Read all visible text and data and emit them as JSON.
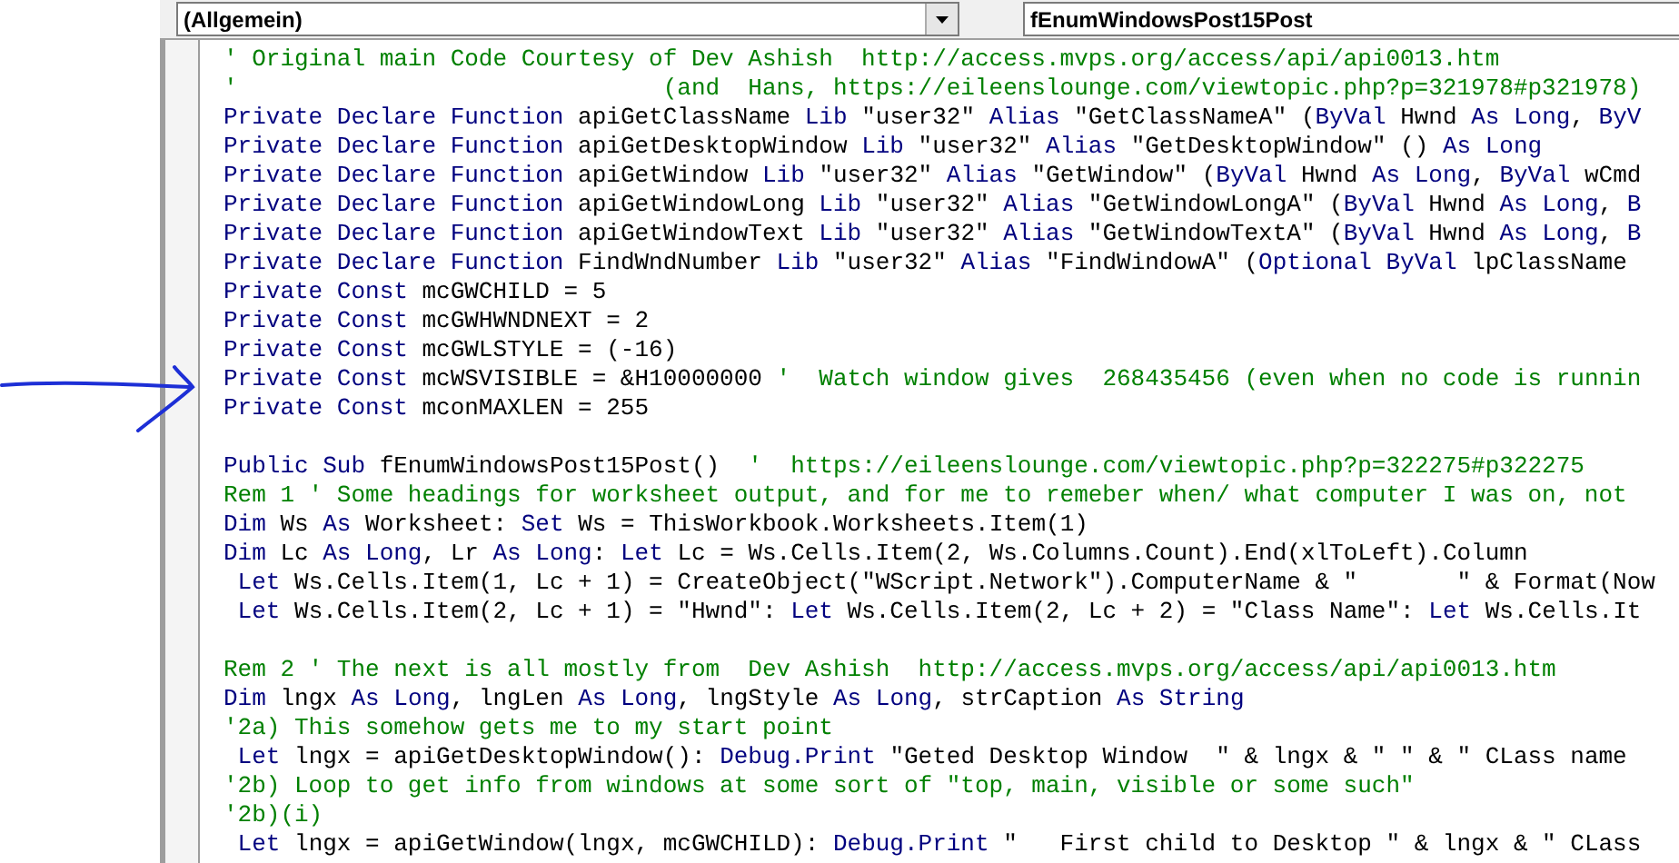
{
  "object_dropdown": {
    "value": "(Allgemein)"
  },
  "procedure_dropdown": {
    "value": "fEnumWindowsPost15Post"
  },
  "code_lines": [
    {
      "kind": "code",
      "segments": [
        {
          "kind": "comment",
          "text": "' Original main Code Courtesy of Dev Ashish  http://access.mvps.org/access/api/api0013.htm"
        }
      ]
    },
    {
      "kind": "code",
      "segments": [
        {
          "kind": "comment",
          "text": "'                              (and  Hans, https://eileenslounge.com/viewtopic.php?p=321978#p321978)"
        }
      ]
    },
    {
      "kind": "code",
      "segments": [
        {
          "kind": "keyword",
          "text": "Private Declare Function "
        },
        {
          "kind": "plain",
          "text": "apiGetClassName "
        },
        {
          "kind": "keyword",
          "text": "Lib "
        },
        {
          "kind": "plain",
          "text": "\"user32\" "
        },
        {
          "kind": "keyword",
          "text": "Alias "
        },
        {
          "kind": "plain",
          "text": "\"GetClassNameA\" ("
        },
        {
          "kind": "keyword",
          "text": "ByVal "
        },
        {
          "kind": "plain",
          "text": "Hwnd "
        },
        {
          "kind": "keyword",
          "text": "As Long"
        },
        {
          "kind": "plain",
          "text": ", "
        },
        {
          "kind": "keyword",
          "text": "ByV"
        }
      ]
    },
    {
      "kind": "code",
      "segments": [
        {
          "kind": "keyword",
          "text": "Private Declare Function "
        },
        {
          "kind": "plain",
          "text": "apiGetDesktopWindow "
        },
        {
          "kind": "keyword",
          "text": "Lib "
        },
        {
          "kind": "plain",
          "text": "\"user32\" "
        },
        {
          "kind": "keyword",
          "text": "Alias "
        },
        {
          "kind": "plain",
          "text": "\"GetDesktopWindow\" () "
        },
        {
          "kind": "keyword",
          "text": "As Long"
        }
      ]
    },
    {
      "kind": "code",
      "segments": [
        {
          "kind": "keyword",
          "text": "Private Declare Function "
        },
        {
          "kind": "plain",
          "text": "apiGetWindow "
        },
        {
          "kind": "keyword",
          "text": "Lib "
        },
        {
          "kind": "plain",
          "text": "\"user32\" "
        },
        {
          "kind": "keyword",
          "text": "Alias "
        },
        {
          "kind": "plain",
          "text": "\"GetWindow\" ("
        },
        {
          "kind": "keyword",
          "text": "ByVal "
        },
        {
          "kind": "plain",
          "text": "Hwnd "
        },
        {
          "kind": "keyword",
          "text": "As Long"
        },
        {
          "kind": "plain",
          "text": ", "
        },
        {
          "kind": "keyword",
          "text": "ByVal "
        },
        {
          "kind": "plain",
          "text": "wCmd"
        }
      ]
    },
    {
      "kind": "code",
      "segments": [
        {
          "kind": "keyword",
          "text": "Private Declare Function "
        },
        {
          "kind": "plain",
          "text": "apiGetWindowLong "
        },
        {
          "kind": "keyword",
          "text": "Lib "
        },
        {
          "kind": "plain",
          "text": "\"user32\" "
        },
        {
          "kind": "keyword",
          "text": "Alias "
        },
        {
          "kind": "plain",
          "text": "\"GetWindowLongA\" ("
        },
        {
          "kind": "keyword",
          "text": "ByVal "
        },
        {
          "kind": "plain",
          "text": "Hwnd "
        },
        {
          "kind": "keyword",
          "text": "As Long"
        },
        {
          "kind": "plain",
          "text": ", "
        },
        {
          "kind": "keyword",
          "text": "B"
        }
      ]
    },
    {
      "kind": "code",
      "segments": [
        {
          "kind": "keyword",
          "text": "Private Declare Function "
        },
        {
          "kind": "plain",
          "text": "apiGetWindowText "
        },
        {
          "kind": "keyword",
          "text": "Lib "
        },
        {
          "kind": "plain",
          "text": "\"user32\" "
        },
        {
          "kind": "keyword",
          "text": "Alias "
        },
        {
          "kind": "plain",
          "text": "\"GetWindowTextA\" ("
        },
        {
          "kind": "keyword",
          "text": "ByVal "
        },
        {
          "kind": "plain",
          "text": "Hwnd "
        },
        {
          "kind": "keyword",
          "text": "As Long"
        },
        {
          "kind": "plain",
          "text": ", "
        },
        {
          "kind": "keyword",
          "text": "B"
        }
      ]
    },
    {
      "kind": "code",
      "segments": [
        {
          "kind": "keyword",
          "text": "Private Declare Function "
        },
        {
          "kind": "plain",
          "text": "FindWndNumber "
        },
        {
          "kind": "keyword",
          "text": "Lib "
        },
        {
          "kind": "plain",
          "text": "\"user32\" "
        },
        {
          "kind": "keyword",
          "text": "Alias "
        },
        {
          "kind": "plain",
          "text": "\"FindWindowA\" ("
        },
        {
          "kind": "keyword",
          "text": "Optional ByVal "
        },
        {
          "kind": "plain",
          "text": "lpClassName"
        }
      ]
    },
    {
      "kind": "code",
      "segments": [
        {
          "kind": "keyword",
          "text": "Private Const "
        },
        {
          "kind": "plain",
          "text": "mcGWCHILD = 5"
        }
      ]
    },
    {
      "kind": "code",
      "segments": [
        {
          "kind": "keyword",
          "text": "Private Const "
        },
        {
          "kind": "plain",
          "text": "mcGWHWNDNEXT = 2"
        }
      ]
    },
    {
      "kind": "code",
      "segments": [
        {
          "kind": "keyword",
          "text": "Private Const "
        },
        {
          "kind": "plain",
          "text": "mcGWLSTYLE = (-16)"
        }
      ]
    },
    {
      "kind": "code",
      "segments": [
        {
          "kind": "keyword",
          "text": "Private Const "
        },
        {
          "kind": "plain",
          "text": "mcWSVISIBLE = &H10000000 "
        },
        {
          "kind": "comment",
          "text": "'  Watch window gives  268435456 (even when no code is runnin"
        }
      ]
    },
    {
      "kind": "code",
      "segments": [
        {
          "kind": "keyword",
          "text": "Private Const "
        },
        {
          "kind": "plain",
          "text": "mconMAXLEN = 255"
        }
      ]
    },
    {
      "kind": "blank"
    },
    {
      "kind": "code",
      "segments": [
        {
          "kind": "keyword",
          "text": "Public Sub "
        },
        {
          "kind": "plain",
          "text": "fEnumWindowsPost15Post()  "
        },
        {
          "kind": "comment",
          "text": "'  https://eileenslounge.com/viewtopic.php?p=322275#p322275"
        }
      ]
    },
    {
      "kind": "code",
      "segments": [
        {
          "kind": "comment",
          "text": "Rem 1 ' Some headings for worksheet output, and for me to remeber when/ what computer I was on, not"
        }
      ]
    },
    {
      "kind": "code",
      "segments": [
        {
          "kind": "keyword",
          "text": "Dim "
        },
        {
          "kind": "plain",
          "text": "Ws "
        },
        {
          "kind": "keyword",
          "text": "As "
        },
        {
          "kind": "plain",
          "text": "Worksheet: "
        },
        {
          "kind": "keyword",
          "text": "Set "
        },
        {
          "kind": "plain",
          "text": "Ws = ThisWorkbook.Worksheets.Item(1)"
        }
      ]
    },
    {
      "kind": "code",
      "segments": [
        {
          "kind": "keyword",
          "text": "Dim "
        },
        {
          "kind": "plain",
          "text": "Lc "
        },
        {
          "kind": "keyword",
          "text": "As Long"
        },
        {
          "kind": "plain",
          "text": ", Lr "
        },
        {
          "kind": "keyword",
          "text": "As Long"
        },
        {
          "kind": "plain",
          "text": ": "
        },
        {
          "kind": "keyword",
          "text": "Let "
        },
        {
          "kind": "plain",
          "text": "Lc = Ws.Cells.Item(2, Ws.Columns.Count).End(xlToLeft).Column"
        }
      ]
    },
    {
      "kind": "code",
      "segments": [
        {
          "kind": "keyword",
          "text": " Let "
        },
        {
          "kind": "plain",
          "text": "Ws.Cells.Item(1, Lc + 1) = CreateObject(\"WScript.Network\").ComputerName & \"       \" & Format(Now"
        }
      ]
    },
    {
      "kind": "code",
      "segments": [
        {
          "kind": "keyword",
          "text": " Let "
        },
        {
          "kind": "plain",
          "text": "Ws.Cells.Item(2, Lc + 1) = \"Hwnd\": "
        },
        {
          "kind": "keyword",
          "text": "Let "
        },
        {
          "kind": "plain",
          "text": "Ws.Cells.Item(2, Lc + 2) = \"Class Name\": "
        },
        {
          "kind": "keyword",
          "text": "Let "
        },
        {
          "kind": "plain",
          "text": "Ws.Cells.It"
        }
      ]
    },
    {
      "kind": "blank"
    },
    {
      "kind": "code",
      "segments": [
        {
          "kind": "comment",
          "text": "Rem 2 ' The next is all mostly from  Dev Ashish  http://access.mvps.org/access/api/api0013.htm"
        }
      ]
    },
    {
      "kind": "code",
      "segments": [
        {
          "kind": "keyword",
          "text": "Dim "
        },
        {
          "kind": "plain",
          "text": "lngx "
        },
        {
          "kind": "keyword",
          "text": "As Long"
        },
        {
          "kind": "plain",
          "text": ", lngLen "
        },
        {
          "kind": "keyword",
          "text": "As Long"
        },
        {
          "kind": "plain",
          "text": ", lngStyle "
        },
        {
          "kind": "keyword",
          "text": "As Long"
        },
        {
          "kind": "plain",
          "text": ", strCaption "
        },
        {
          "kind": "keyword",
          "text": "As String"
        }
      ]
    },
    {
      "kind": "code",
      "segments": [
        {
          "kind": "comment",
          "text": "'2a) This somehow gets me to my start point"
        }
      ]
    },
    {
      "kind": "code",
      "segments": [
        {
          "kind": "keyword",
          "text": " Let "
        },
        {
          "kind": "plain",
          "text": "lngx = apiGetDesktopWindow(): "
        },
        {
          "kind": "keyword",
          "text": "Debug.Print "
        },
        {
          "kind": "plain",
          "text": "\"Geted Desktop Window  \" & lngx & \" \" & \" CLass name"
        }
      ]
    },
    {
      "kind": "code",
      "segments": [
        {
          "kind": "comment",
          "text": "'2b) Loop to get info from windows at some sort of \"top, main, visible or some such\""
        }
      ]
    },
    {
      "kind": "code",
      "segments": [
        {
          "kind": "comment",
          "text": "'2b)(i)"
        }
      ]
    },
    {
      "kind": "code",
      "segments": [
        {
          "kind": "keyword",
          "text": " Let "
        },
        {
          "kind": "plain",
          "text": "lngx = apiGetWindow(lngx, mcGWCHILD): "
        },
        {
          "kind": "keyword",
          "text": "Debug.Print "
        },
        {
          "kind": "plain",
          "text": "\"   First child to Desktop \" & lngx & \" CLass"
        }
      ]
    }
  ]
}
